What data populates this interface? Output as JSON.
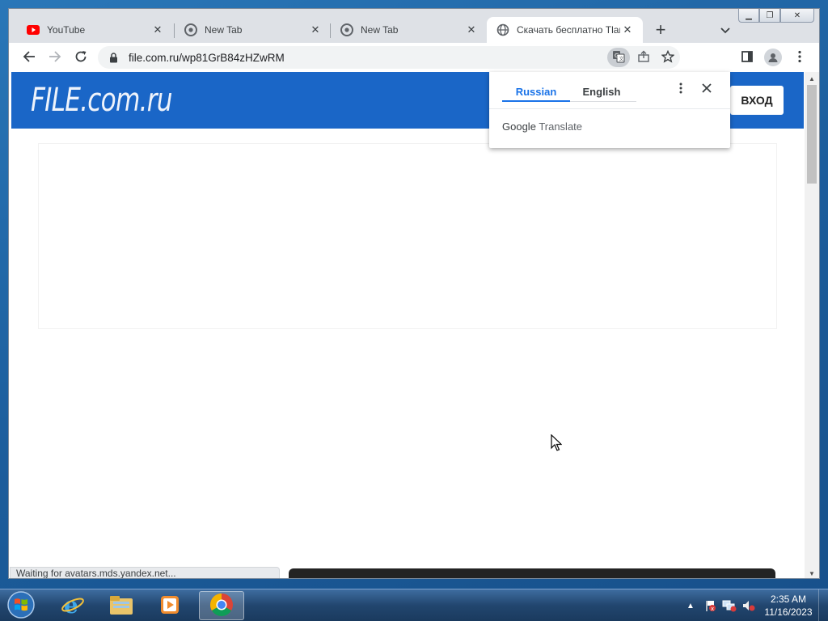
{
  "browser": {
    "tabs": [
      {
        "title": "YouTube",
        "icon": "youtube-icon",
        "active": false
      },
      {
        "title": "New Tab",
        "icon": "chrome-icon",
        "active": false
      },
      {
        "title": "New Tab",
        "icon": "chrome-icon",
        "active": false
      },
      {
        "title": "Скачать бесплатно Тlaк",
        "icon": "globe-icon",
        "active": true
      }
    ],
    "url": "file.com.ru/wp81GrB84zHZwRM",
    "status_text": "Waiting for avatars.mds.yandex.net..."
  },
  "site": {
    "logo_text": "FILE.com.ru",
    "login_label": "ВХОД",
    "brand_color": "#1a66c7"
  },
  "translate_popup": {
    "source_lang": "Russian",
    "target_lang": "English",
    "brand_google": "Google",
    "brand_translate": "Translate"
  },
  "taskbar": {
    "apps": [
      {
        "name": "internet-explorer-icon",
        "active": false
      },
      {
        "name": "file-explorer-icon",
        "active": false
      },
      {
        "name": "media-player-icon",
        "active": false
      },
      {
        "name": "chrome-icon",
        "active": true
      }
    ],
    "time": "2:35 AM",
    "date": "11/16/2023"
  }
}
